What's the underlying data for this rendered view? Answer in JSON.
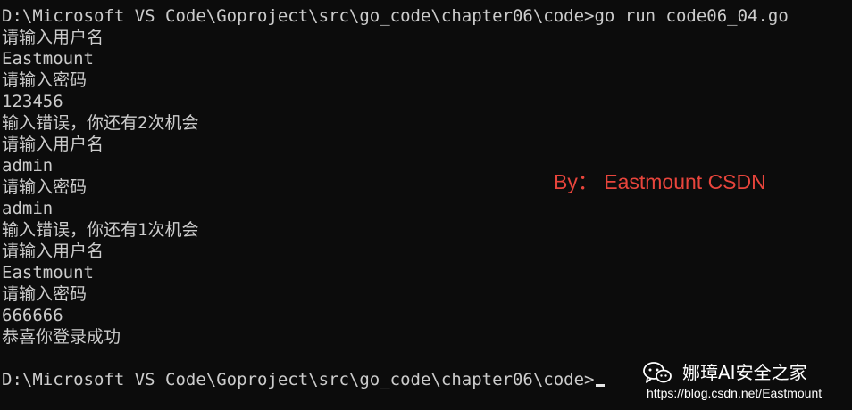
{
  "terminal": {
    "lines": [
      "D:\\Microsoft VS Code\\Goproject\\src\\go_code\\chapter06\\code>go run code06_04.go",
      "请输入用户名",
      "Eastmount",
      "请输入密码",
      "123456",
      "输入错误，你还有2次机会",
      "请输入用户名",
      "admin",
      "请输入密码",
      "admin",
      "输入错误，你还有1次机会",
      "请输入用户名",
      "Eastmount",
      "请输入密码",
      "666666",
      "恭喜你登录成功",
      "",
      "D:\\Microsoft VS Code\\Goproject\\src\\go_code\\chapter06\\code>"
    ]
  },
  "watermark": {
    "text": "By： Eastmount CSDN",
    "color": "#e8453c"
  },
  "brand": {
    "icon": "wechat-icon",
    "name": "娜璋AI安全之家",
    "url": "https://blog.csdn.net/Eastmount"
  },
  "colors": {
    "background": "#0c0c0c",
    "text": "#cccccc"
  }
}
